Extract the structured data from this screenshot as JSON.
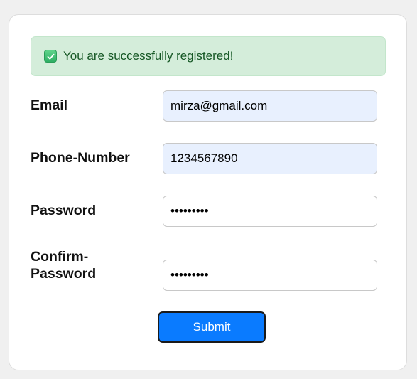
{
  "alert": {
    "message": "You are successfully registered!",
    "icon": "check-box-icon",
    "color": "#d4edda",
    "text_color": "#155724"
  },
  "form": {
    "email": {
      "label": "Email",
      "value": "mirza@gmail.com"
    },
    "phone": {
      "label": "Phone-Number",
      "value": "1234567890"
    },
    "password": {
      "label": "Password",
      "value": "•••••••••"
    },
    "confirm_password": {
      "label_line1": "Confirm-",
      "label_line2": "Password",
      "value": "•••••••••"
    },
    "submit_label": "Submit",
    "submit_color": "#0a7bff"
  }
}
